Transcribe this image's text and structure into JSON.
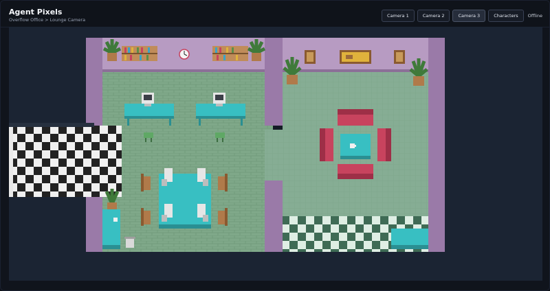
{
  "app": {
    "title": "Agent Pixels",
    "breadcrumb": "Overflow Office > Lounge Camera"
  },
  "tabs": [
    {
      "label": "Camera 1",
      "active": false
    },
    {
      "label": "Camera 2",
      "active": false
    },
    {
      "label": "Camera 3",
      "active": true
    },
    {
      "label": "Characters",
      "active": false
    }
  ],
  "status": "Offline",
  "colors": {
    "background": "#0e1117",
    "viewport": "#1b2433",
    "wall_purple": "#b79bc2",
    "pillar_purple": "#9a7aa8",
    "floor_green_brick": "#7fa889",
    "floor_green_tile": "#86ad94",
    "desk_teal": "#38bfc2",
    "sofa_red": "#c8435e"
  },
  "scene": {
    "icons": [
      "bookshelf-icon",
      "wall-clock-icon",
      "potted-plant-icon",
      "computer-icon",
      "stool-icon",
      "chair-icon",
      "sofa-icon",
      "coffee-mug-icon",
      "picture-frame-icon",
      "trash-can-icon"
    ]
  }
}
